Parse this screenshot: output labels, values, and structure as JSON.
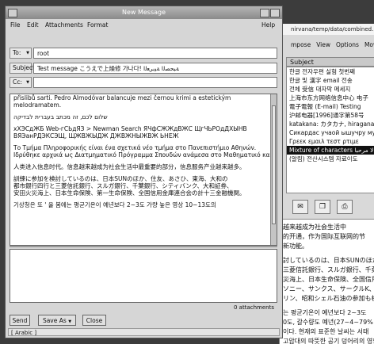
{
  "compose": {
    "title": "New Message",
    "menu": {
      "file": "File",
      "edit": "Edit",
      "attachments": "Attachments",
      "format": "Format",
      "help": "Help"
    },
    "to_label": "To:",
    "to_value": "root",
    "subject_label": "Subject:",
    "subject_value": "Test message こうえで上燥修 가나다! ﺔﺒﺤﺼﻟا ﺔﻴﺑﺮﻌﻟا",
    "cc_label": "Cc:",
    "cc_value": "",
    "body_lines": [
      "přislibů sarti. Pedro Almodóvar balancuje mezi černou krimi a estetickým",
      "melodramatem.",
      "",
      "שלום לכם, זה מכתב בעברית לבדיקה",
      "",
      "хХЭСдЖБ Web-гСЬдЯЗ > Newman Search ЯЧфСЖЖдВЖС ЩгЧЬРОдДХЫНВ",
      "ВЯЭанРДЭКСЭЩ, ЩЖВЖЫДЖ ДЖВЖНЫЖВЖ ЬНЕЖ",
      "",
      "Το Τμήμα Πληροφορικής είναι ένα σχετικά νέο τμήμα στο Πανεπιστήμιο Αθηνών.",
      "Ιδρύθηκε αρχικά ως Διατμηματικό Πρόγραμμα Σπουδών ανάμεσα στο Μαθηματικό και",
      "",
      "人类进入信息时代。信息越来越成为社会生活中最重要的部分，信息服务产业越来越多。",
      "",
      "訓練に参加を検討しているのは、日本SUNのほか、住友、あさひ、東海、大和の",
      "都市銀行四行と三菱信託銀行、スルガ銀行、千葉銀行、シティバンク、大和証券、",
      "安田火災海上、日本生命保険、第一生命保険、全国信用金庫連合会の計十三金融機関。",
      "",
      "기상청은 또 ' 올 봄에는 평균기온이 예년보다 2~3도 가량 높은 영상 10~13도의"
    ],
    "attachments_count": "0 attachments",
    "buttons": {
      "send": "Send",
      "save_as": "Save As",
      "close": "Close"
    },
    "status": "[ Arabic ]"
  },
  "background_window": {
    "path": "nirvana/temp/data/combined.mb",
    "menu": {
      "compose": "mpose",
      "view": "View",
      "options": "Options",
      "move": "Move"
    },
    "subject_header": "Subject",
    "rows": [
      "한글 전자우편 실험 첫번째",
      "한글 및 漢字 email 전송",
      "전체 受信 대자막 메세지",
      "上海市东方网络信息中心 电子",
      "電子電報 (E-mail) Testing",
      "沪邮电器[1996]通字第58号",
      "katakana: カタカナ, hiragana",
      "Сикардас учаой ышучру мутее",
      "Γρεεκ εμαιλ τεστ ρτιμε",
      "Mixture of characters لا مرحبا",
      "(알림) 전산시스템 자료이도"
    ],
    "selected_index": 9,
    "icons": [
      "envelope-icon",
      "copy-icon",
      "print-icon"
    ],
    "body_lines": [
      "越来越成为社会生活中",
      "的开通，作为国际互联网的节",
      "新功能。",
      "",
      "討しているのは、日本SUNのほか、住",
      "三菱信託銀行、スルガ銀行、千葉銀",
      "災海上、日本生命保険、全国信用",
      "ソニー、サンクス、サークルK、ミニス",
      "リン、昭和シェル石油の参加も検討",
      "",
      "는 평균기온이 예년보다 2~3도",
      "0도, 갈수량도 예년(27~4~79%",
      "이다. 현재의 표준한 날씨는 서태",
      "고압대의 따뜻한 공기 덩어리의 영향이"
    ]
  }
}
